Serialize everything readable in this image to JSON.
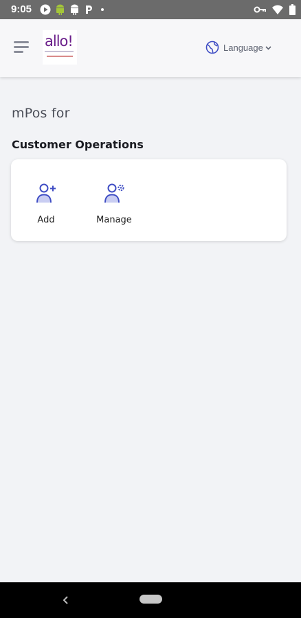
{
  "status_bar": {
    "time": "9:05",
    "left_icons": [
      "play-circle-icon",
      "android-icon",
      "android-icon",
      "p-icon",
      "dot-icon"
    ],
    "right_icons": [
      "key-icon",
      "wifi-icon",
      "battery-icon"
    ]
  },
  "header": {
    "menu_icon": "hamburger-menu-icon",
    "logo_text": "allo!",
    "language_label": "Language",
    "language_icon": "globe-icon"
  },
  "main": {
    "subtitle": "mPos for",
    "section_title": "Customer Operations",
    "operations": [
      {
        "label": "Add",
        "icon": "add-user-icon"
      },
      {
        "label": "Manage",
        "icon": "manage-user-icon"
      }
    ]
  },
  "colors": {
    "accent": "#3f4dc4",
    "accent_light": "#c9cdf2",
    "logo_purple": "#6a1e8a"
  }
}
